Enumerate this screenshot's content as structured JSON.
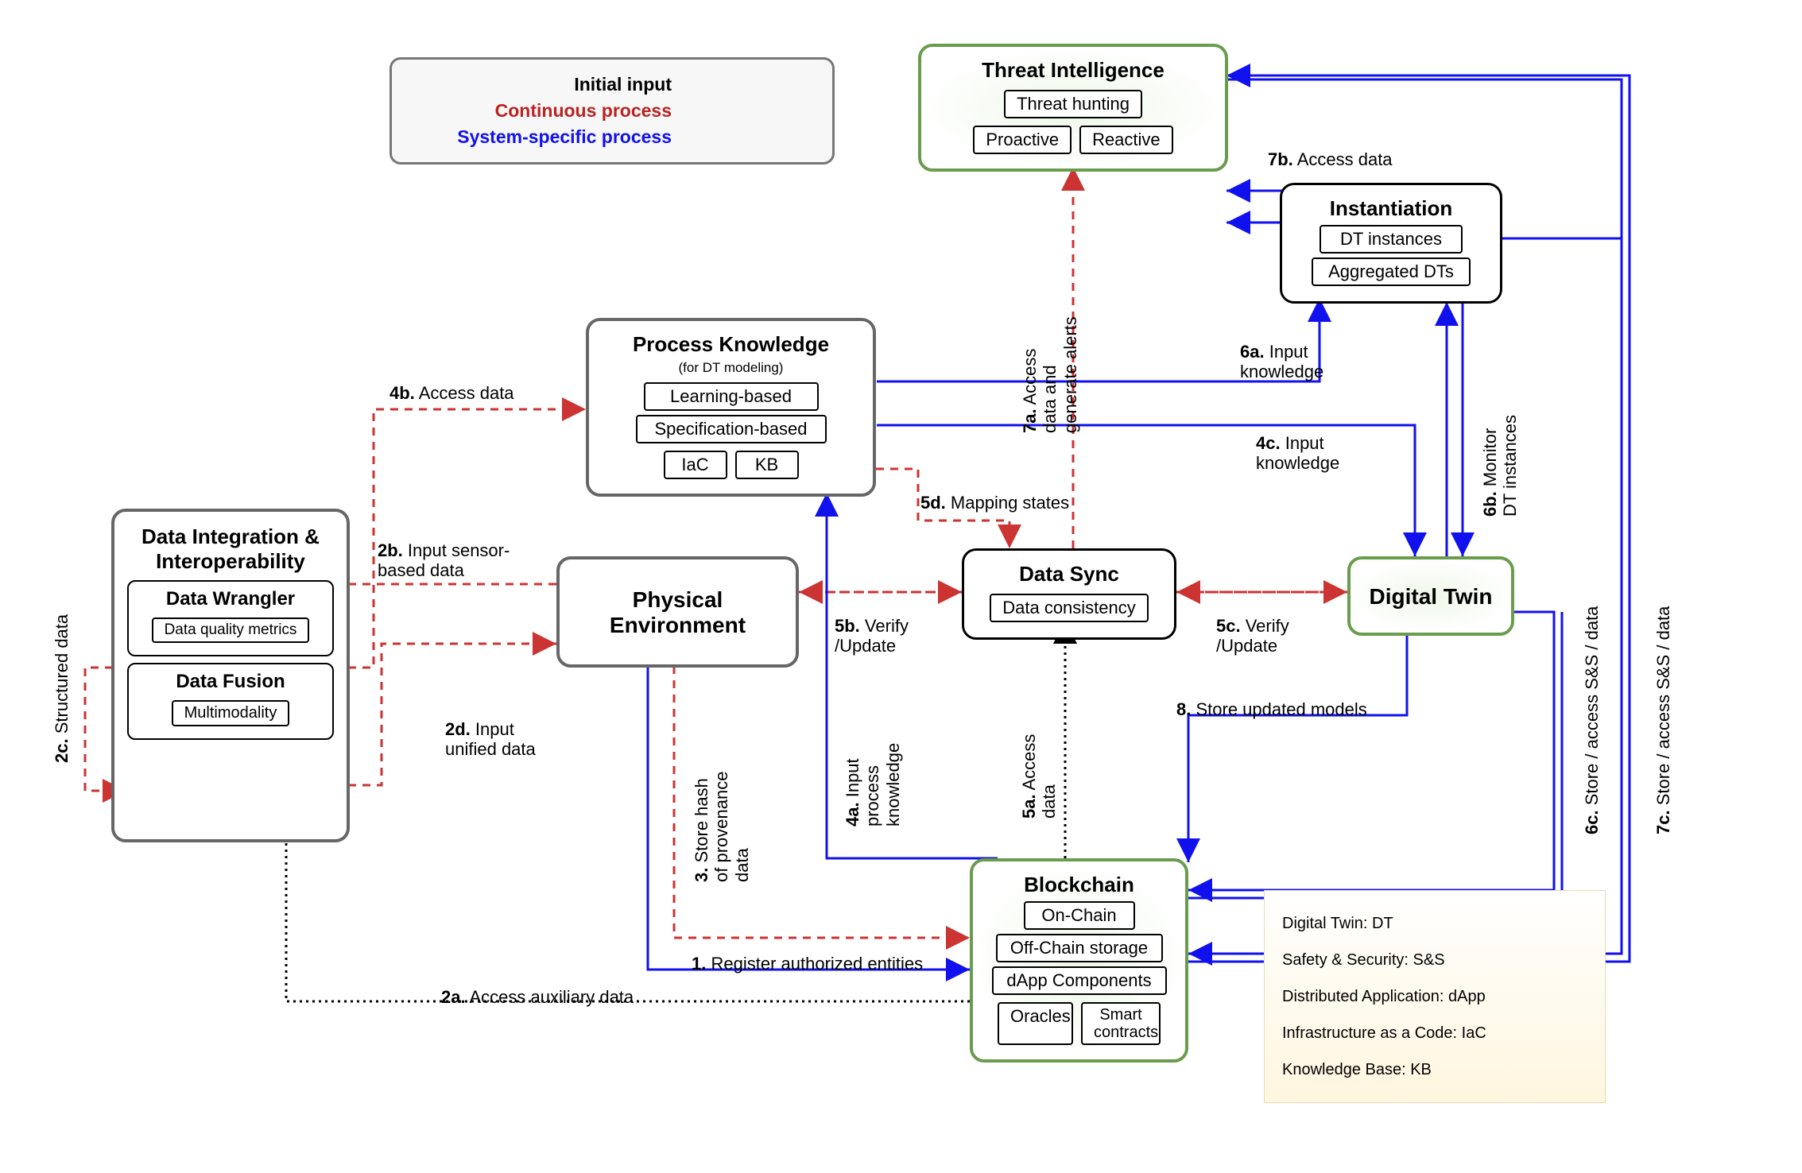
{
  "legend": {
    "initial": "Initial input",
    "continuous": "Continuous process",
    "system": "System-specific process"
  },
  "boxes": {
    "dataIntegration": {
      "title": "Data Integration &\nInteroperability",
      "wrangler": {
        "title": "Data Wrangler",
        "sub": "Data quality metrics"
      },
      "fusion": {
        "title": "Data Fusion",
        "sub": "Multimodality"
      }
    },
    "processKnowledge": {
      "title": "Process Knowledge",
      "subtitle": "(for DT modeling)",
      "items": {
        "learning": "Learning-based",
        "spec": "Specification-based",
        "iac": "IaC",
        "kb": "KB"
      }
    },
    "physicalEnv": {
      "title": "Physical\nEnvironment"
    },
    "threatIntel": {
      "title": "Threat Intelligence",
      "items": {
        "hunting": "Threat hunting",
        "proactive": "Proactive",
        "reactive": "Reactive"
      }
    },
    "instantiation": {
      "title": "Instantiation",
      "items": {
        "dt": "DT instances",
        "agg": "Aggregated DTs"
      }
    },
    "dataSync": {
      "title": "Data Sync",
      "item": "Data consistency"
    },
    "digitalTwin": {
      "title": "Digital Twin"
    },
    "blockchain": {
      "title": "Blockchain",
      "items": {
        "onchain": "On-Chain",
        "offchain": "Off-Chain storage",
        "dapp": "dApp Components",
        "oracles": "Oracles",
        "smart": "Smart\ncontracts"
      }
    }
  },
  "edges": {
    "e1": "Register authorized entities",
    "e2a": "Access auxiliary data",
    "e2b": "Input sensor-\nbased data",
    "e2c": "Structured data",
    "e2d": "Input\nunified data",
    "e3": "Store hash\nof provenance\ndata",
    "e4a": "Input\nprocess\nknowledge",
    "e4b": "Access data",
    "e4c": "Input\nknowledge",
    "e5a": "Access\ndata",
    "e5b": "Verify\n/Update",
    "e5c": "Verify\n/Update",
    "e5d": "Mapping states",
    "e6a": "Input\nknowledge",
    "e6b": "Monitor\nDT instances",
    "e6c": "Store / access S&S / data",
    "e7a": "Access\ndata and\ngenerate alerts",
    "e7b": "Access data",
    "e7c": "Store / access S&S / data",
    "e8": "Store updated models"
  },
  "edgeNums": {
    "n1": "1.",
    "n2a": "2a.",
    "n2b": "2b.",
    "n2c": "2c.",
    "n2d": "2d.",
    "n3": "3.",
    "n4a": "4a.",
    "n4b": "4b.",
    "n4c": "4c.",
    "n5a": "5a.",
    "n5b": "5b.",
    "n5c": "5c.",
    "n5d": "5d.",
    "n6a": "6a.",
    "n6b": "6b.",
    "n6c": "6c.",
    "n7a": "7a.",
    "n7b": "7b.",
    "n7c": "7c.",
    "n8": "8."
  },
  "glossary": {
    "dt": "Digital Twin: DT",
    "ss": "Safety & Security: S&S",
    "dapp": "Distributed Application: dApp",
    "iac": "Infrastructure as a Code: IaC",
    "kb": "Knowledge Base: KB"
  }
}
